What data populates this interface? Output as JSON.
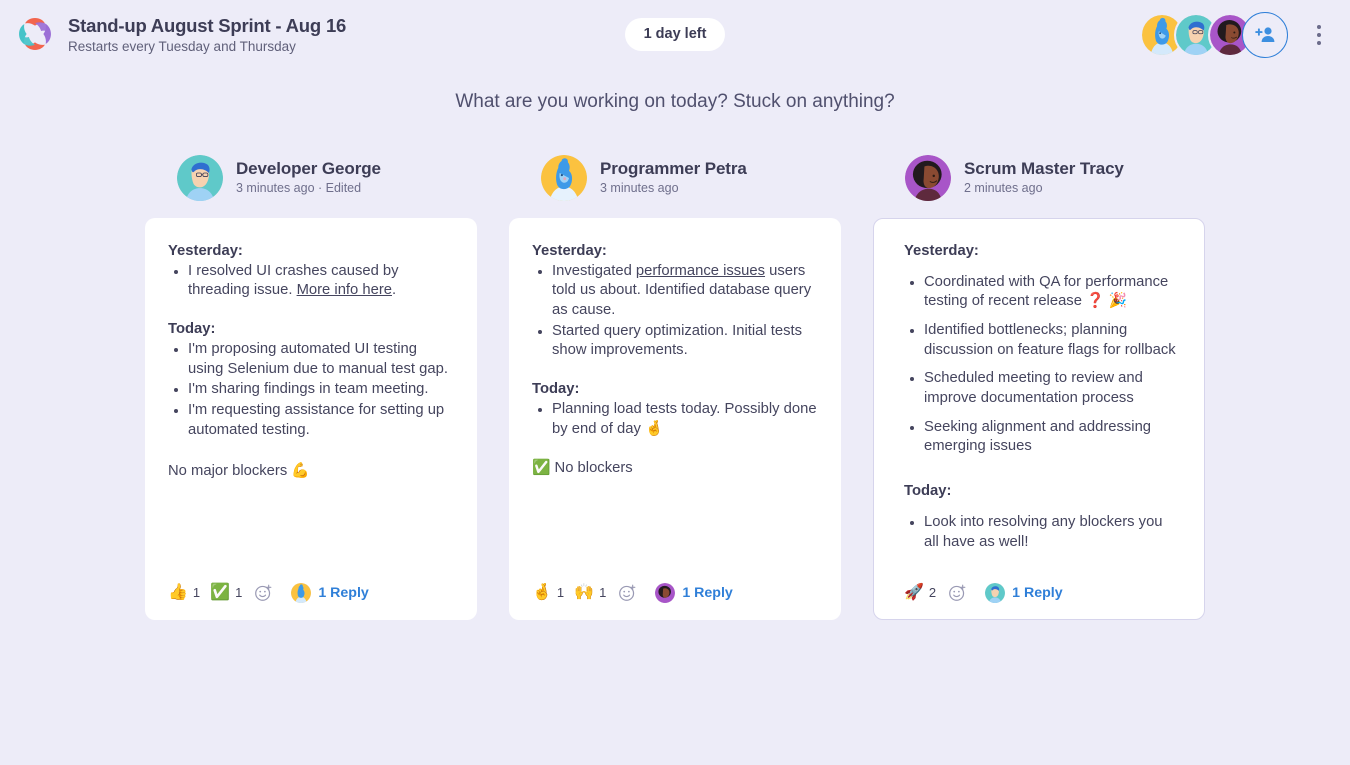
{
  "header": {
    "logo_icon": "pinwheel-logo-icon",
    "title": "Stand-up August Sprint - Aug 16",
    "subtitle": "Restarts every Tuesday and Thursday",
    "day_badge": "1 day left",
    "add_person_icon": "add-person-icon",
    "menu_icon": "kebab-menu-icon"
  },
  "prompt": "What are you working on today? Stuck on anything?",
  "colors": {
    "background": "#edecf8",
    "card": "#ffffff",
    "accent_link": "#2f7fd8",
    "text_primary": "#3d3d56",
    "text_body": "#45455e",
    "text_muted": "#6f6f8c",
    "card_selected_border": "#d6d4ec"
  },
  "columns": [
    {
      "author": "Developer George",
      "avatar": "avatar-george",
      "timestamp": "3 minutes ago · Edited",
      "selected": false,
      "sections": [
        {
          "label": "Yesterday:",
          "bullets": [
            {
              "pre": "I resolved UI crashes caused by threading issue. ",
              "link": "More info here",
              "post": "."
            }
          ]
        },
        {
          "label": "Today:",
          "bullets": [
            {
              "pre": "I'm proposing automated UI testing using Selenium due to manual test gap."
            },
            {
              "pre": "I'm sharing findings in team meeting."
            },
            {
              "pre": "I'm requesting assistance for setting up automated testing."
            }
          ]
        }
      ],
      "footer_text": "No major blockers 💪",
      "reactions": [
        {
          "emoji": "👍",
          "name": "thumbs-up-reaction",
          "count": "1"
        },
        {
          "emoji": "✅",
          "name": "check-mark-reaction",
          "count": "1"
        }
      ],
      "add_reaction_icon": "add-reaction-icon",
      "reply_avatar": "avatar-petra",
      "reply_label": "1 Reply"
    },
    {
      "author": "Programmer Petra",
      "avatar": "avatar-petra",
      "timestamp": "3 minutes ago",
      "selected": false,
      "sections": [
        {
          "label": "Yesterday:",
          "bullets": [
            {
              "pre": "Investigated ",
              "link": "performance issues",
              "post": " users told us about. Identified database query as cause."
            },
            {
              "pre": "Started query optimization. Initial tests show improvements."
            }
          ]
        },
        {
          "label": "Today:",
          "bullets": [
            {
              "pre": "Planning load tests today. Possibly done by end of day 🤞"
            }
          ]
        }
      ],
      "footer_text": "✅ No blockers",
      "reactions": [
        {
          "emoji": "🤞",
          "name": "crossed-fingers-reaction",
          "count": "1"
        },
        {
          "emoji": "🙌",
          "name": "raised-hands-reaction",
          "count": "1"
        }
      ],
      "add_reaction_icon": "add-reaction-icon",
      "reply_avatar": "avatar-tracy",
      "reply_label": "1 Reply"
    },
    {
      "author": "Scrum Master Tracy",
      "avatar": "avatar-tracy",
      "timestamp": "2 minutes ago",
      "selected": true,
      "sections": [
        {
          "label": "Yesterday:",
          "bullets": [
            {
              "pre": "Coordinated with QA for performance testing of recent release  ❓ 🎉"
            },
            {
              "pre": "Identified bottlenecks; planning discussion on feature flags for rollback"
            },
            {
              "pre": "Scheduled meeting to review and improve documentation process"
            },
            {
              "pre": "Seeking alignment and addressing emerging issues"
            }
          ]
        },
        {
          "label": "Today:",
          "bullets": [
            {
              "pre": "Look into resolving any blockers you all have as well!"
            }
          ]
        }
      ],
      "footer_text": "",
      "reactions": [
        {
          "emoji": "🚀",
          "name": "rocket-reaction",
          "count": "2"
        }
      ],
      "add_reaction_icon": "add-reaction-icon",
      "reply_avatar": "avatar-george",
      "reply_label": "1 Reply"
    }
  ],
  "header_avatars": [
    "avatar-petra",
    "avatar-george",
    "avatar-tracy"
  ]
}
